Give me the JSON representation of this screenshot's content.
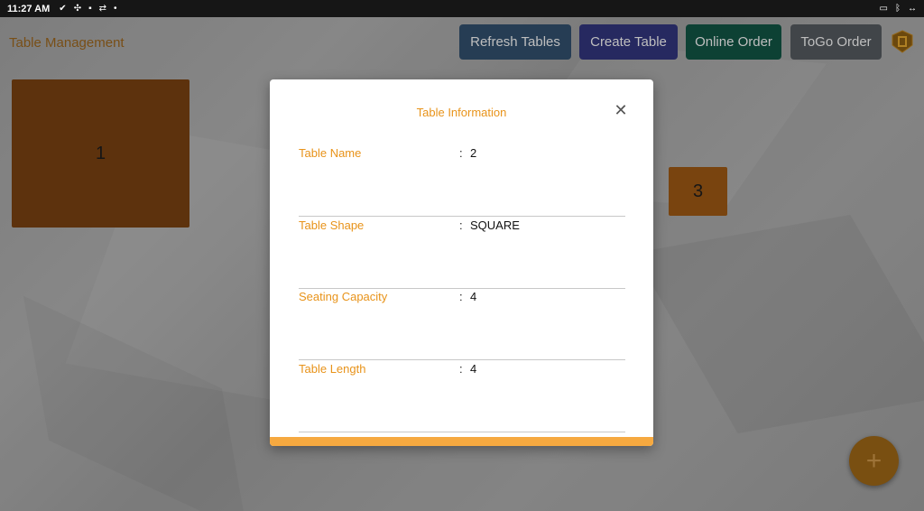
{
  "status_bar": {
    "time": "11:27 AM",
    "left_icons": [
      "check-icon",
      "fan-icon",
      "app-icon",
      "teamviewer-icon",
      "dot-icon"
    ],
    "right_icons": [
      "cast-icon",
      "bluetooth-icon",
      "link-icon"
    ]
  },
  "app": {
    "title": "Table Management",
    "buttons": {
      "refresh": "Refresh Tables",
      "create": "Create Table",
      "online": "Online Order",
      "togo": "ToGo Order"
    },
    "tables": [
      {
        "label": "1"
      },
      {
        "label": "3"
      }
    ],
    "fab_label": "+"
  },
  "dialog": {
    "title": "Table Information",
    "close_label": "✕",
    "rows": [
      {
        "label": "Table Name",
        "colon": ":",
        "value": "2"
      },
      {
        "label": "Table Shape",
        "colon": ":",
        "value": "SQUARE"
      },
      {
        "label": "Seating Capacity",
        "colon": ":",
        "value": "4"
      },
      {
        "label": "Table Length",
        "colon": ":",
        "value": "4"
      }
    ]
  },
  "colors": {
    "accent": "#e8931a",
    "footer_bar": "#f6a940",
    "table": "#6a3a0f"
  }
}
